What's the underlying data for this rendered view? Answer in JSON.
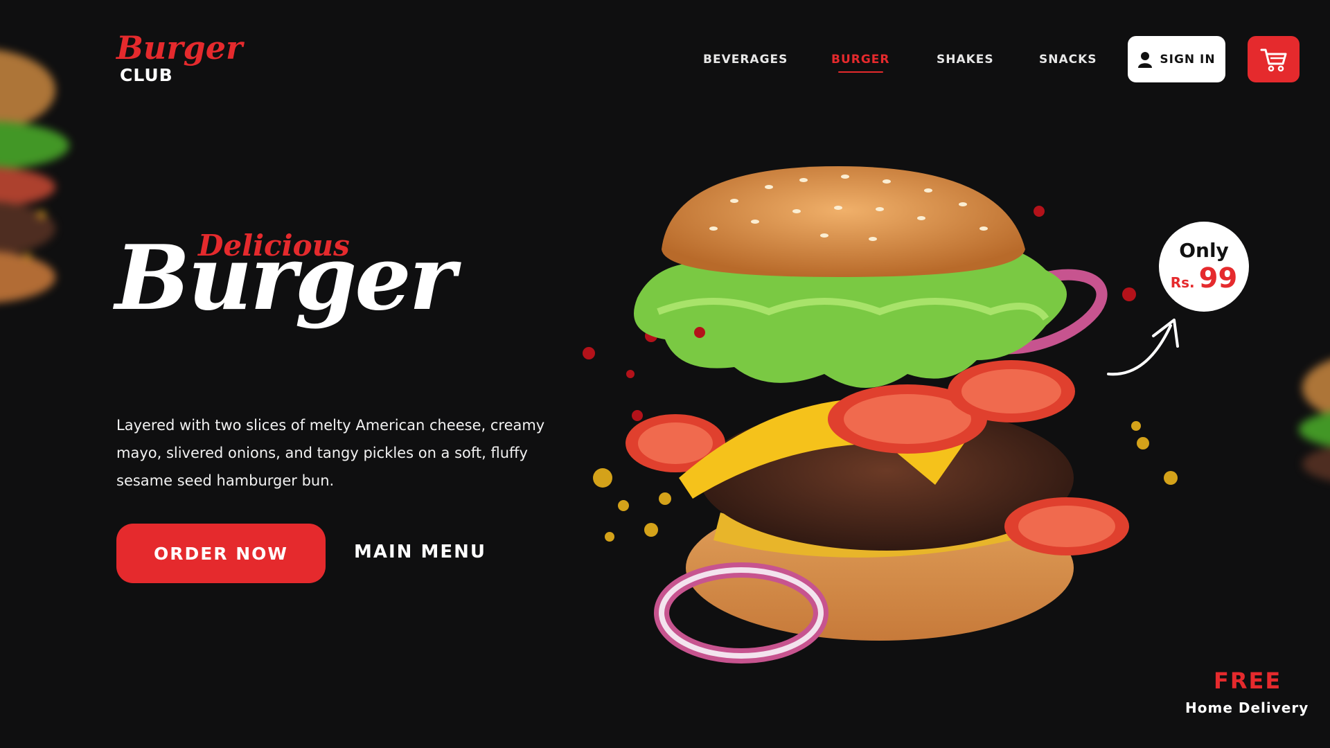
{
  "logo": {
    "script": "Burger",
    "sub": "CLUB"
  },
  "nav": {
    "items": [
      {
        "label": "BEVERAGES",
        "active": false
      },
      {
        "label": "BURGER",
        "active": true
      },
      {
        "label": "SHAKES",
        "active": false
      },
      {
        "label": "SNACKS",
        "active": false
      }
    ],
    "signin_label": "SIGN IN",
    "signin_icon": "user-icon",
    "cart_icon": "cart-icon"
  },
  "hero": {
    "subtitle": "Delicious",
    "title": "Burger",
    "description": "Layered with two slices of melty American cheese, creamy mayo, slivered onions, and tangy pickles on a soft, fluffy sesame seed hamburger bun.",
    "order_label": "ORDER NOW",
    "menu_label": "MAIN MENU"
  },
  "price": {
    "prefix": "Only",
    "currency": "Rs.",
    "value": "99"
  },
  "delivery": {
    "headline": "FREE",
    "text": "Home Delivery"
  },
  "colors": {
    "accent": "#e52a2d",
    "background": "#0f0f10",
    "text": "#ffffff"
  }
}
